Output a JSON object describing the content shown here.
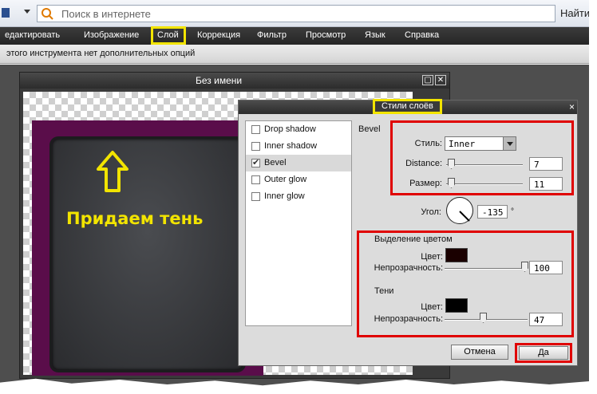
{
  "browser": {
    "search_placeholder": "Поиск в интернете",
    "find_label": "Найти"
  },
  "menu": {
    "items": [
      {
        "label": "едактировать"
      },
      {
        "label": "Изображение"
      },
      {
        "label": "Слой"
      },
      {
        "label": "Коррекция"
      },
      {
        "label": "Фильтр"
      },
      {
        "label": "Просмотр"
      },
      {
        "label": "Язык"
      },
      {
        "label": "Справка"
      }
    ],
    "highlighted": "Слой"
  },
  "options_bar": {
    "text": "этого инструмента нет дополнительных опций"
  },
  "image_window": {
    "title": "Без имени",
    "caption": "Придаем тень"
  },
  "dialog": {
    "title": "Стили слоёв",
    "close_glyph": "×",
    "styles": [
      {
        "label": "Drop shadow",
        "checked": false
      },
      {
        "label": "Inner shadow",
        "checked": false
      },
      {
        "label": "Bevel",
        "checked": true
      },
      {
        "label": "Outer glow",
        "checked": false
      },
      {
        "label": "Inner glow",
        "checked": false
      }
    ],
    "section_title": "Bevel",
    "style_label": "Стиль:",
    "style_value": "Inner",
    "distance_label": "Distance:",
    "distance_value": "7",
    "size_label": "Размер:",
    "size_value": "11",
    "angle_label": "Угол:",
    "angle_value": "-135",
    "angle_unit": "°",
    "highlight_title": "Выделение цветом",
    "highlight_color_label": "Цвет:",
    "highlight_color": "#1a0000",
    "highlight_opacity_label": "Непрозрачность:",
    "highlight_opacity_value": "100",
    "shadow_title": "Тени",
    "shadow_color_label": "Цвет:",
    "shadow_color": "#000000",
    "shadow_opacity_label": "Непрозрачность:",
    "shadow_opacity_value": "47",
    "cancel_label": "Отмена",
    "ok_label": "Да"
  },
  "colors": {
    "annotation_yellow": "#f2e400",
    "annotation_red": "#e00000",
    "purple_frame": "#5a0d4a"
  }
}
